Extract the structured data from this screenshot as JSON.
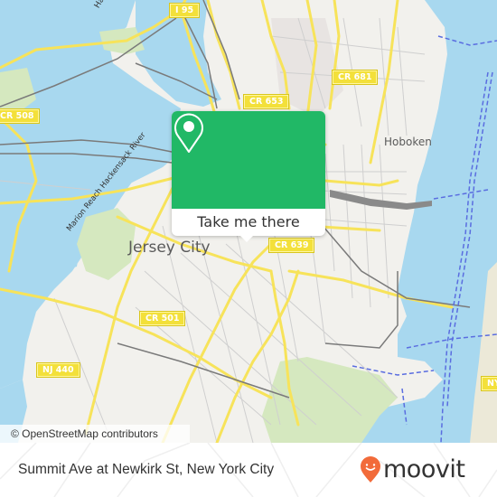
{
  "map": {
    "colors": {
      "land": "#f2f1ed",
      "water": "#a8d8ef",
      "park": "#d5e8bf",
      "road_major": "#f7e35a",
      "road_minor": "#cfcfcf",
      "rail": "#7a7a7a",
      "ferry": "#5a6de0"
    },
    "route_shields": [
      {
        "label": "I 95"
      },
      {
        "label": "CR 508"
      },
      {
        "label": "CR 653"
      },
      {
        "label": "CR 681"
      },
      {
        "label": "CR 639"
      },
      {
        "label": "CR 501"
      },
      {
        "label": "NJ 440"
      },
      {
        "label": "NY"
      }
    ],
    "place_labels": [
      {
        "label": "Jersey City"
      },
      {
        "label": "Hoboken"
      }
    ],
    "water_labels": [
      {
        "label": "Hackensack"
      },
      {
        "label": "Marion Reach Hackensack River"
      }
    ],
    "attribution": "© OpenStreetMap contributors"
  },
  "popup": {
    "button_label": "Take me there",
    "accent_color": "#21b866",
    "icon": "location-pin-icon"
  },
  "footer": {
    "stop_title": "Summit Ave at Newkirk St, New York City",
    "brand": "moovit",
    "brand_color": "#f26b3a",
    "brand_icon": "moovit-smile-pin-icon"
  }
}
